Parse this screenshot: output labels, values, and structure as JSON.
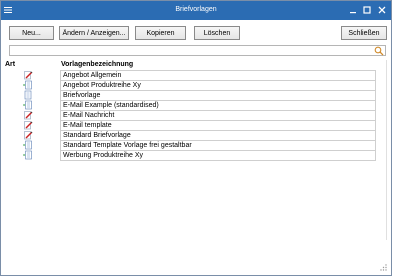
{
  "window": {
    "title": "Briefvorlagen",
    "controls": {
      "minimize": "minimize-icon",
      "maximize": "maximize-icon",
      "close": "close-icon"
    }
  },
  "toolbar": {
    "new_label": "Neu...",
    "edit_label": "Ändern / Anzeigen...",
    "copy_label": "Kopieren",
    "delete_label": "Löschen",
    "close_label": "Schließen"
  },
  "search": {
    "value": "",
    "placeholder": "",
    "icon": "search-icon"
  },
  "table": {
    "columns": [
      "Art",
      "Vorlagenbezeichnung"
    ],
    "rows": [
      {
        "icon": "edit-pencil-icon",
        "name": "Angebot Allgemein"
      },
      {
        "icon": "document-arrow-icon",
        "name": "Angebot Produktreihe Xy"
      },
      {
        "icon": "document-icon",
        "name": "Briefvorlage"
      },
      {
        "icon": "document-arrow-icon",
        "name": "E-Mail Example (standardised)"
      },
      {
        "icon": "edit-pencil-icon",
        "name": "E-Mail Nachricht"
      },
      {
        "icon": "edit-pencil-icon",
        "name": "E-Mail template"
      },
      {
        "icon": "edit-pencil-icon",
        "name": "Standard Briefvorlage"
      },
      {
        "icon": "document-arrow-icon",
        "name": "Standard Template Vorlage frei gestaltbar"
      },
      {
        "icon": "document-arrow-icon",
        "name": "Werbung Produktreihe Xy"
      }
    ]
  },
  "colors": {
    "titlebar": "#2b6cb3",
    "border": "#7a8ea8"
  }
}
